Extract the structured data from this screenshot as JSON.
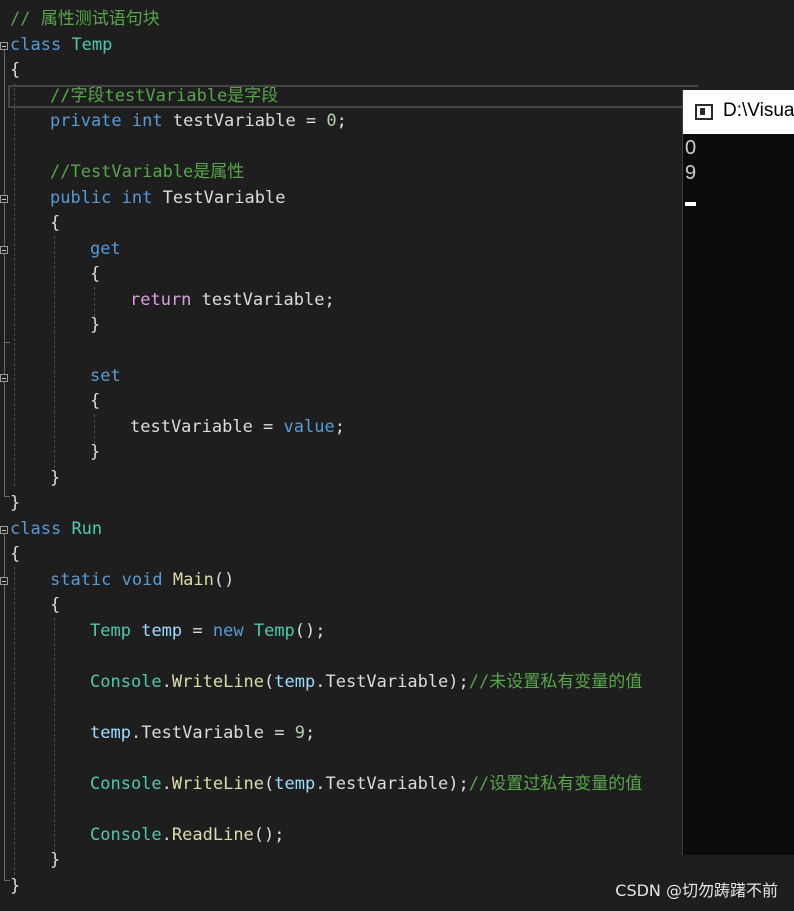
{
  "editor": {
    "header_comment": "// 属性测试语句块",
    "class_temp": {
      "kw": "class",
      "name": "Temp"
    },
    "brace_open": "{",
    "brace_close": "}",
    "comment_field": "//字段testVariable是字段",
    "field_decl": {
      "mod": "private",
      "type": "int",
      "rest": " testVariable = ",
      "num": "0",
      "end": ";"
    },
    "comment_prop": "//TestVariable是属性",
    "prop_decl": {
      "mod": "public",
      "type": "int",
      "name": "TestVariable"
    },
    "get_kw": "get",
    "return_stmt": {
      "kw": "return",
      "rest": " testVariable;"
    },
    "set_kw": "set",
    "assign_stmt": {
      "lhs": "testVariable = ",
      "kw": "value",
      "end": ";"
    },
    "class_run": {
      "kw": "class",
      "name": "Run"
    },
    "main_decl": {
      "mod": "static",
      "type": "void",
      "name": "Main",
      "args": "()"
    },
    "new_stmt": {
      "type": "Temp",
      "var": "temp",
      "eq": " = ",
      "kw": "new",
      "ctor": "Temp",
      "end": "();"
    },
    "writeline1": {
      "cls": "Console",
      "dot": ".",
      "fn": "WriteLine",
      "p1": "(",
      "var": "temp",
      "rest": ".TestVariable);",
      "comment": "//未设置私有变量的值"
    },
    "assign9": {
      "var": "temp",
      "rest": ".TestVariable = ",
      "num": "9",
      "end": ";"
    },
    "writeline2": {
      "cls": "Console",
      "dot": ".",
      "fn": "WriteLine",
      "p1": "(",
      "var": "temp",
      "rest": ".TestVariable);",
      "comment": "//设置过私有变量的值"
    },
    "readline": {
      "cls": "Console",
      "dot": ".",
      "fn": "ReadLine",
      "end": "();"
    }
  },
  "console": {
    "title": "D:\\Visua",
    "lines": [
      "0",
      "9"
    ]
  },
  "watermark": "CSDN @切勿踌躇不前",
  "colors": {
    "background": "#1e1e1e",
    "keyword": "#569cd6",
    "type": "#4ec9b0",
    "comment": "#57a64a",
    "method": "#dcdcaa",
    "variable": "#9cdcfe",
    "control": "#d8a0df",
    "number": "#b5cea8"
  }
}
